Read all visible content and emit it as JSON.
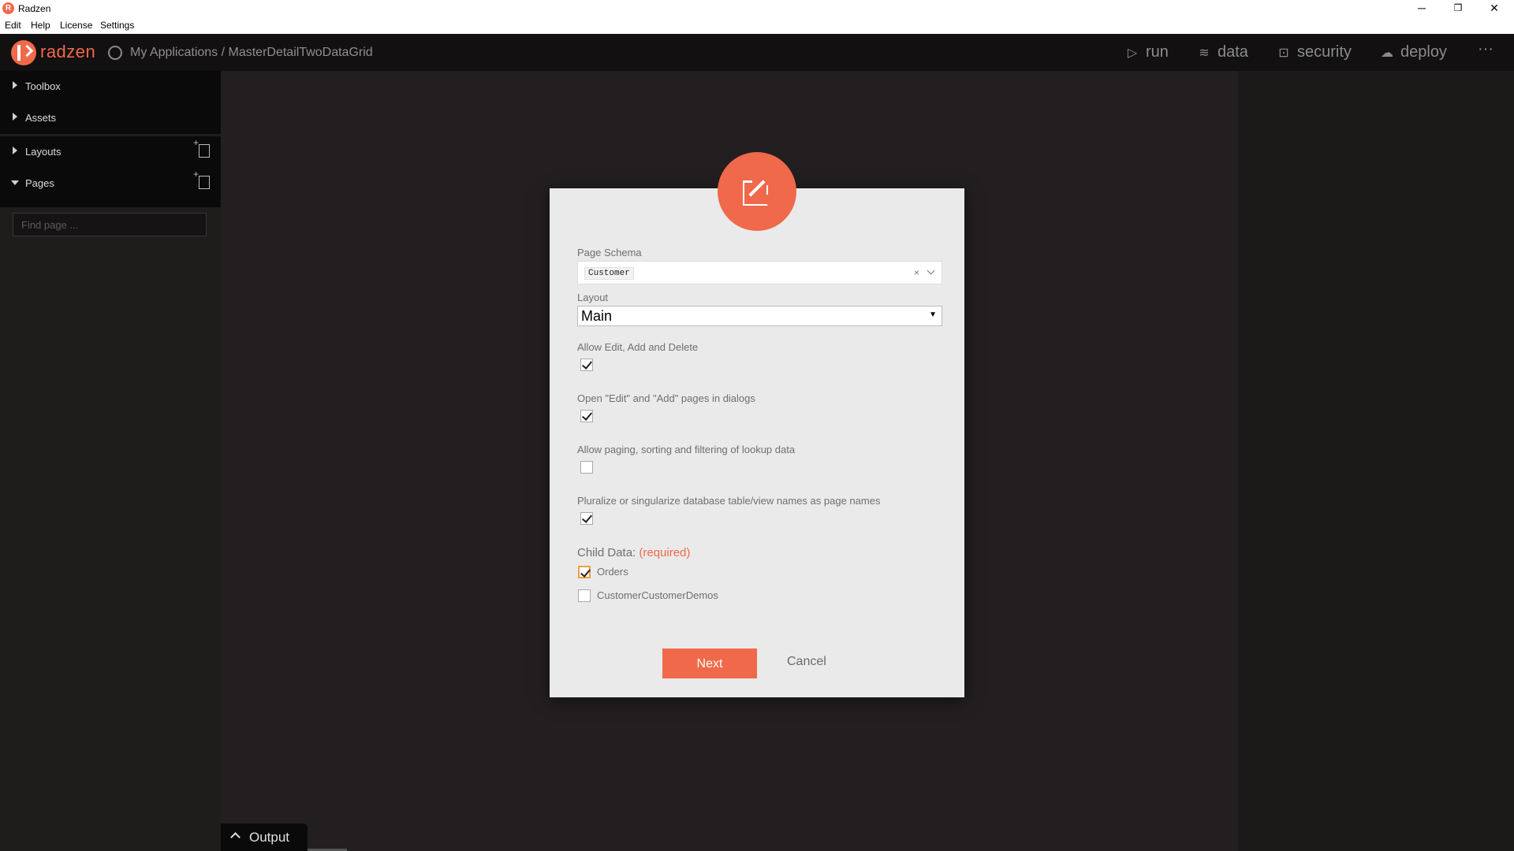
{
  "window": {
    "title": "Radzen",
    "logo_letter": "R",
    "controls": {
      "minimize": "─",
      "restore": "❐",
      "close": "✕"
    }
  },
  "menubar": {
    "items": [
      "Edit",
      "Help",
      "License",
      "Settings"
    ]
  },
  "appbar": {
    "brand": "radzen",
    "breadcrumb": "My Applications / MasterDetailTwoDataGrid",
    "nav": [
      {
        "label": "run",
        "icon": "play-icon"
      },
      {
        "label": "data",
        "icon": "layers-icon"
      },
      {
        "label": "security",
        "icon": "lock-icon"
      },
      {
        "label": "deploy",
        "icon": "cloud-upload-icon"
      }
    ],
    "more": "···"
  },
  "sidebar": {
    "items": [
      {
        "label": "Toolbox",
        "expanded": false
      },
      {
        "label": "Assets",
        "expanded": false
      },
      {
        "label": "Layouts",
        "expanded": false
      },
      {
        "label": "Pages",
        "expanded": true
      }
    ],
    "find_placeholder": "Find page ..."
  },
  "dialog": {
    "page_schema_label": "Page Schema",
    "page_schema_value": "Customer",
    "clear_glyph": "×",
    "layout_label": "Layout",
    "layout_value": "Main",
    "layout_caret": "▼",
    "options": [
      {
        "label": "Allow Edit, Add and Delete",
        "checked": true
      },
      {
        "label": "Open \"Edit\" and \"Add\" pages in dialogs",
        "checked": true
      },
      {
        "label": "Allow paging, sorting and filtering of lookup data",
        "checked": false
      },
      {
        "label": "Pluralize or singularize database table/view names as page names",
        "checked": true
      }
    ],
    "child_data_label": "Child Data:",
    "child_data_required": "(required)",
    "child_items": [
      {
        "label": "Orders",
        "checked": true
      },
      {
        "label": "CustomerCustomerDemos",
        "checked": false
      }
    ],
    "next_label": "Next",
    "cancel_label": "Cancel"
  },
  "output": {
    "label": "Output"
  }
}
